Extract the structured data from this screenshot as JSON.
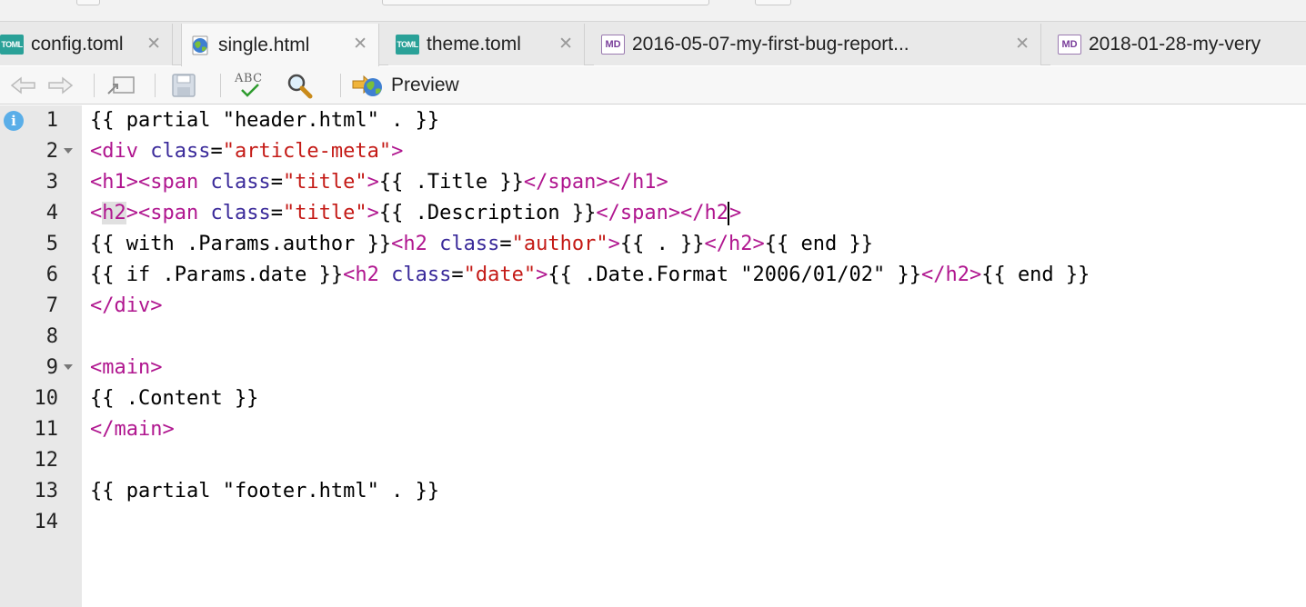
{
  "tabs": [
    {
      "label": "config.toml",
      "icon": "toml-file-icon",
      "active": false
    },
    {
      "label": "single.html",
      "icon": "html-file-icon",
      "active": true
    },
    {
      "label": "theme.toml",
      "icon": "toml-file-icon",
      "active": false
    },
    {
      "label": "2016-05-07-my-first-bug-report...",
      "icon": "md-file-icon",
      "active": false
    },
    {
      "label": "2018-01-28-my-very",
      "icon": "md-file-icon",
      "active": false
    }
  ],
  "file_badges": {
    "toml": "TOML",
    "md": "MD"
  },
  "toolbar": {
    "preview_label": "Preview",
    "spellcheck_badge": "ABC"
  },
  "editor": {
    "line_numbers": [
      "1",
      "2",
      "3",
      "4",
      "5",
      "6",
      "7",
      "8",
      "9",
      "10",
      "11",
      "12",
      "13",
      "14"
    ],
    "info_marker": "i",
    "lines": [
      [
        {
          "t": "plain",
          "v": "{{ partial \"header.html\" . }}"
        }
      ],
      [
        {
          "t": "tag",
          "v": "<div "
        },
        {
          "t": "attr",
          "v": "class"
        },
        {
          "t": "plain",
          "v": "="
        },
        {
          "t": "str",
          "v": "\"article-meta\""
        },
        {
          "t": "tag",
          "v": ">"
        }
      ],
      [
        {
          "t": "tag",
          "v": "<h1><span "
        },
        {
          "t": "attr",
          "v": "class"
        },
        {
          "t": "plain",
          "v": "="
        },
        {
          "t": "str",
          "v": "\"title\""
        },
        {
          "t": "tag",
          "v": ">"
        },
        {
          "t": "plain",
          "v": "{{ .Title }}"
        },
        {
          "t": "tag",
          "v": "</span></h1>"
        }
      ],
      [
        {
          "t": "tag",
          "v": "<"
        },
        {
          "t": "tagm",
          "v": "h2"
        },
        {
          "t": "tag",
          "v": "><span "
        },
        {
          "t": "attr",
          "v": "class"
        },
        {
          "t": "plain",
          "v": "="
        },
        {
          "t": "str",
          "v": "\"title\""
        },
        {
          "t": "tag",
          "v": ">"
        },
        {
          "t": "plain",
          "v": "{{ .Description }}"
        },
        {
          "t": "tag",
          "v": "</span></h2"
        },
        {
          "t": "cursor",
          "v": ""
        },
        {
          "t": "tag",
          "v": ">"
        }
      ],
      [
        {
          "t": "plain",
          "v": "{{ with .Params.author }}"
        },
        {
          "t": "tag",
          "v": "<h2 "
        },
        {
          "t": "attr",
          "v": "class"
        },
        {
          "t": "plain",
          "v": "="
        },
        {
          "t": "str",
          "v": "\"author\""
        },
        {
          "t": "tag",
          "v": ">"
        },
        {
          "t": "plain",
          "v": "{{ . }}"
        },
        {
          "t": "tag",
          "v": "</h2>"
        },
        {
          "t": "plain",
          "v": "{{ end }}"
        }
      ],
      [
        {
          "t": "plain",
          "v": "{{ if .Params.date }}"
        },
        {
          "t": "tag",
          "v": "<h2 "
        },
        {
          "t": "attr",
          "v": "class"
        },
        {
          "t": "plain",
          "v": "="
        },
        {
          "t": "str",
          "v": "\"date\""
        },
        {
          "t": "tag",
          "v": ">"
        },
        {
          "t": "plain",
          "v": "{{ .Date.Format \"2006/01/02\" }}"
        },
        {
          "t": "tag",
          "v": "</h2>"
        },
        {
          "t": "plain",
          "v": "{{ end }}"
        }
      ],
      [
        {
          "t": "tag",
          "v": "</div>"
        }
      ],
      [],
      [
        {
          "t": "tag",
          "v": "<main>"
        }
      ],
      [
        {
          "t": "plain",
          "v": "{{ .Content }}"
        }
      ],
      [
        {
          "t": "tag",
          "v": "</main>"
        }
      ],
      [],
      [
        {
          "t": "plain",
          "v": "{{ partial \"footer.html\" . }}"
        }
      ],
      []
    ],
    "fold_lines": [
      2,
      9
    ]
  },
  "colors": {
    "tag": "#b0168f",
    "attribute": "#3a2a9a",
    "string": "#c41a16",
    "gutter": "#e8e8e8"
  }
}
